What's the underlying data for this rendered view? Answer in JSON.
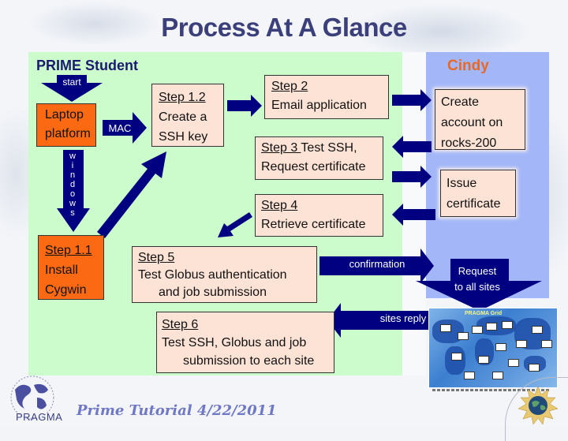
{
  "title": "Process At A Glance",
  "panels": {
    "student": "PRIME Student",
    "cindy": "Cindy"
  },
  "nodes": {
    "laptop": [
      "Laptop",
      "platform"
    ],
    "step1_1": {
      "step": "Step 1.1",
      "lines": [
        "Install",
        "Cygwin"
      ]
    },
    "step1_2": {
      "step": "Step 1.2",
      "lines": [
        "Create a",
        "SSH key"
      ]
    },
    "step2": {
      "step": "Step 2",
      "lines": [
        "Email application"
      ]
    },
    "step3": {
      "step": "Step 3 ",
      "rest": "Test SSH,",
      "lines": [
        "Request certificate"
      ]
    },
    "step4": {
      "step": "Step 4",
      "lines": [
        "Retrieve certificate"
      ]
    },
    "step5": {
      "step": "Step 5",
      "lines": [
        "Test Globus authentication",
        "and job submission"
      ]
    },
    "step6": {
      "step": "Step 6",
      "lines": [
        "Test SSH, Globus and job",
        "submission to each site"
      ]
    },
    "create_account": [
      "Create",
      "account on",
      "rocks-200"
    ],
    "issue_cert": [
      "Issue",
      "certificate"
    ]
  },
  "arrows": {
    "start": "start",
    "mac": "MAC",
    "windows": [
      "w",
      "i",
      "n",
      "d",
      "o",
      "w",
      "s"
    ],
    "confirmation": "confirmation",
    "request": [
      "Request",
      "to all sites"
    ],
    "sites_reply": "sites reply"
  },
  "world_map": {
    "title": "PRAGMA Grid"
  },
  "footer": {
    "text": "Prime Tutorial 4/22/2011",
    "logo": "PRAGMA"
  },
  "colors": {
    "title": "#3b3f7a",
    "arrow": "#000080",
    "student_panel": "#ccfccc",
    "cindy_panel": "#a3b7f8",
    "box": "#fde3d6",
    "orange_box": "#fb6a12",
    "cindy_label": "#e56a2a"
  }
}
